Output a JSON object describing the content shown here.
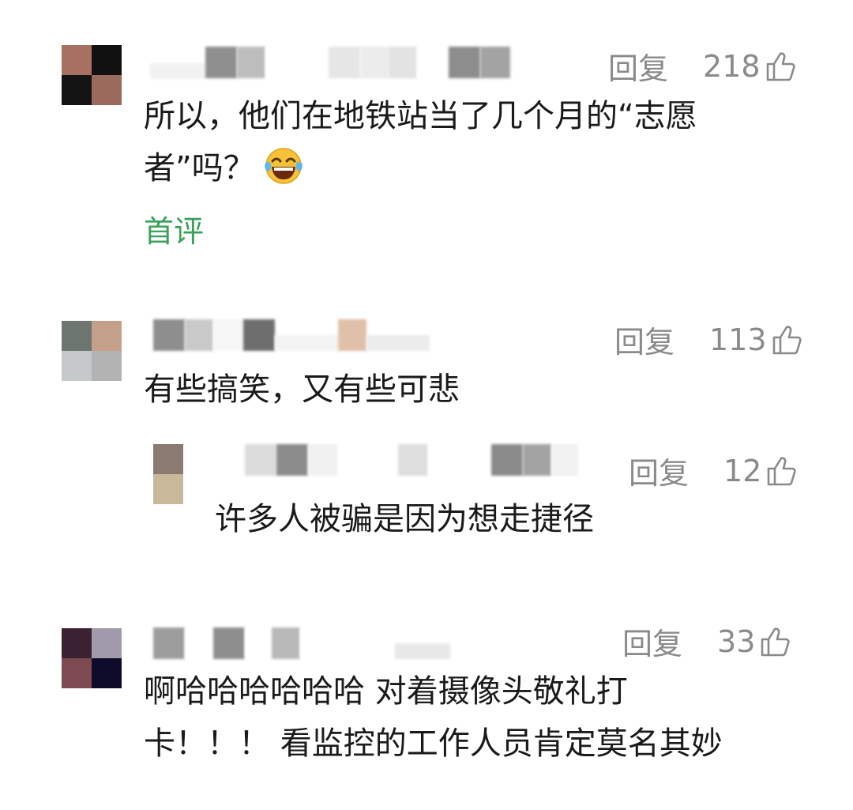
{
  "comments": [
    {
      "reply_label": "回复",
      "likes": "218",
      "lines": [
        "所以，他们在地铁站当了几个月的“志愿",
        "者”吗？"
      ],
      "emoji": "laughing-tears-emoji",
      "tag": "首评",
      "avatar_colors": [
        "#a87060",
        "#111111",
        "#141414",
        "#9a6b5c"
      ],
      "name_colors": [
        "#b8b8b8",
        "#8f8f8f",
        "#bdbdbd",
        "#e6e6e6",
        "#ececec",
        "#e3e3e3",
        "#8d8d8d",
        "#a3a3a3"
      ]
    },
    {
      "reply_label": "回复",
      "likes": "113",
      "lines": [
        "有些搞笑，又有些可悲"
      ],
      "avatar_colors": [
        "#6c7570",
        "#c4a08b",
        "#c6c9c9",
        "#b3b3b3"
      ],
      "name_colors": [
        "#8e8e8e",
        "#c9c9c9",
        "#6e6e6e",
        "#e0c0a8",
        "#d7d7d7"
      ]
    },
    {
      "reply_label": "回复",
      "likes": "12",
      "lines": [
        "许多人被骗是因为想走捷径"
      ],
      "avatar_colors": [
        "#8a7a70",
        "#c9b89a"
      ],
      "name_colors": [
        "#dcdcdc",
        "#8c8c8c",
        "#f0f0f0",
        "#dedede",
        "#8a8a8a",
        "#a3a3a3"
      ]
    },
    {
      "reply_label": "回复",
      "likes": "33",
      "lines": [
        "啊哈哈哈哈哈哈 对着摄像头敬礼打",
        "卡！！！ 看监控的工作人员肯定莫名其妙"
      ],
      "avatar_colors": [
        "#3b2232",
        "#a19aaa",
        "#7e4a52",
        "#0e0b2a"
      ],
      "name_colors": [
        "#9d9d9d",
        "#8e8e8e",
        "#b9b9b9",
        "#e8e8e8"
      ]
    }
  ],
  "colors": {
    "meta": "#8a8a8a",
    "tag": "#3aa05a",
    "text": "#1a1a1a"
  }
}
